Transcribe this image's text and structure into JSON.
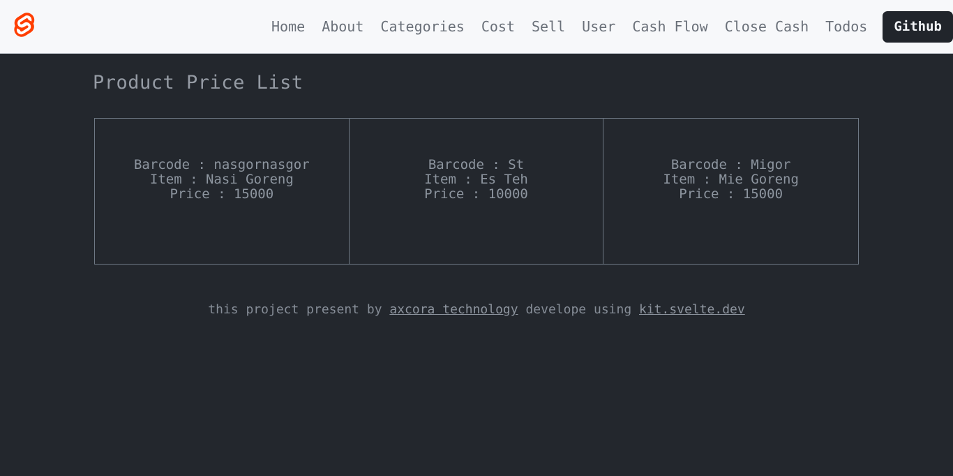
{
  "header": {
    "logo_icon": "svelte-logo-icon",
    "logo_color": "#ff3e00",
    "nav_items": [
      {
        "label": "Home"
      },
      {
        "label": "About"
      },
      {
        "label": "Categories"
      },
      {
        "label": "Cost"
      },
      {
        "label": "Sell"
      },
      {
        "label": "User"
      },
      {
        "label": "Cash Flow"
      },
      {
        "label": "Close Cash"
      },
      {
        "label": "Todos"
      }
    ],
    "github_button": "Github",
    "background": "#f7f8fa"
  },
  "main": {
    "page_title": "Product Price List",
    "background": "#23272d",
    "text_color": "#8d959f",
    "cards": [
      {
        "barcode_line": "Barcode : nasgornasgor",
        "item_line": "Item : Nasi Goreng",
        "price_line": "Price : 15000",
        "barcode": "nasgornasgor",
        "item": "Nasi Goreng",
        "price": "15000"
      },
      {
        "barcode_line": "Barcode : St",
        "item_line": "Item : Es Teh",
        "price_line": "Price : 10000",
        "barcode": "St",
        "item": "Es Teh",
        "price": "10000"
      },
      {
        "barcode_line": "Barcode : Migor",
        "item_line": "Item : Mie Goreng",
        "price_line": "Price : 15000",
        "barcode": "Migor",
        "item": "Mie Goreng",
        "price": "15000"
      }
    ]
  },
  "footer": {
    "text_before": "this project present by ",
    "link1": "axcora technology",
    "text_middle": " develope using ",
    "link2": "kit.svelte.dev"
  }
}
